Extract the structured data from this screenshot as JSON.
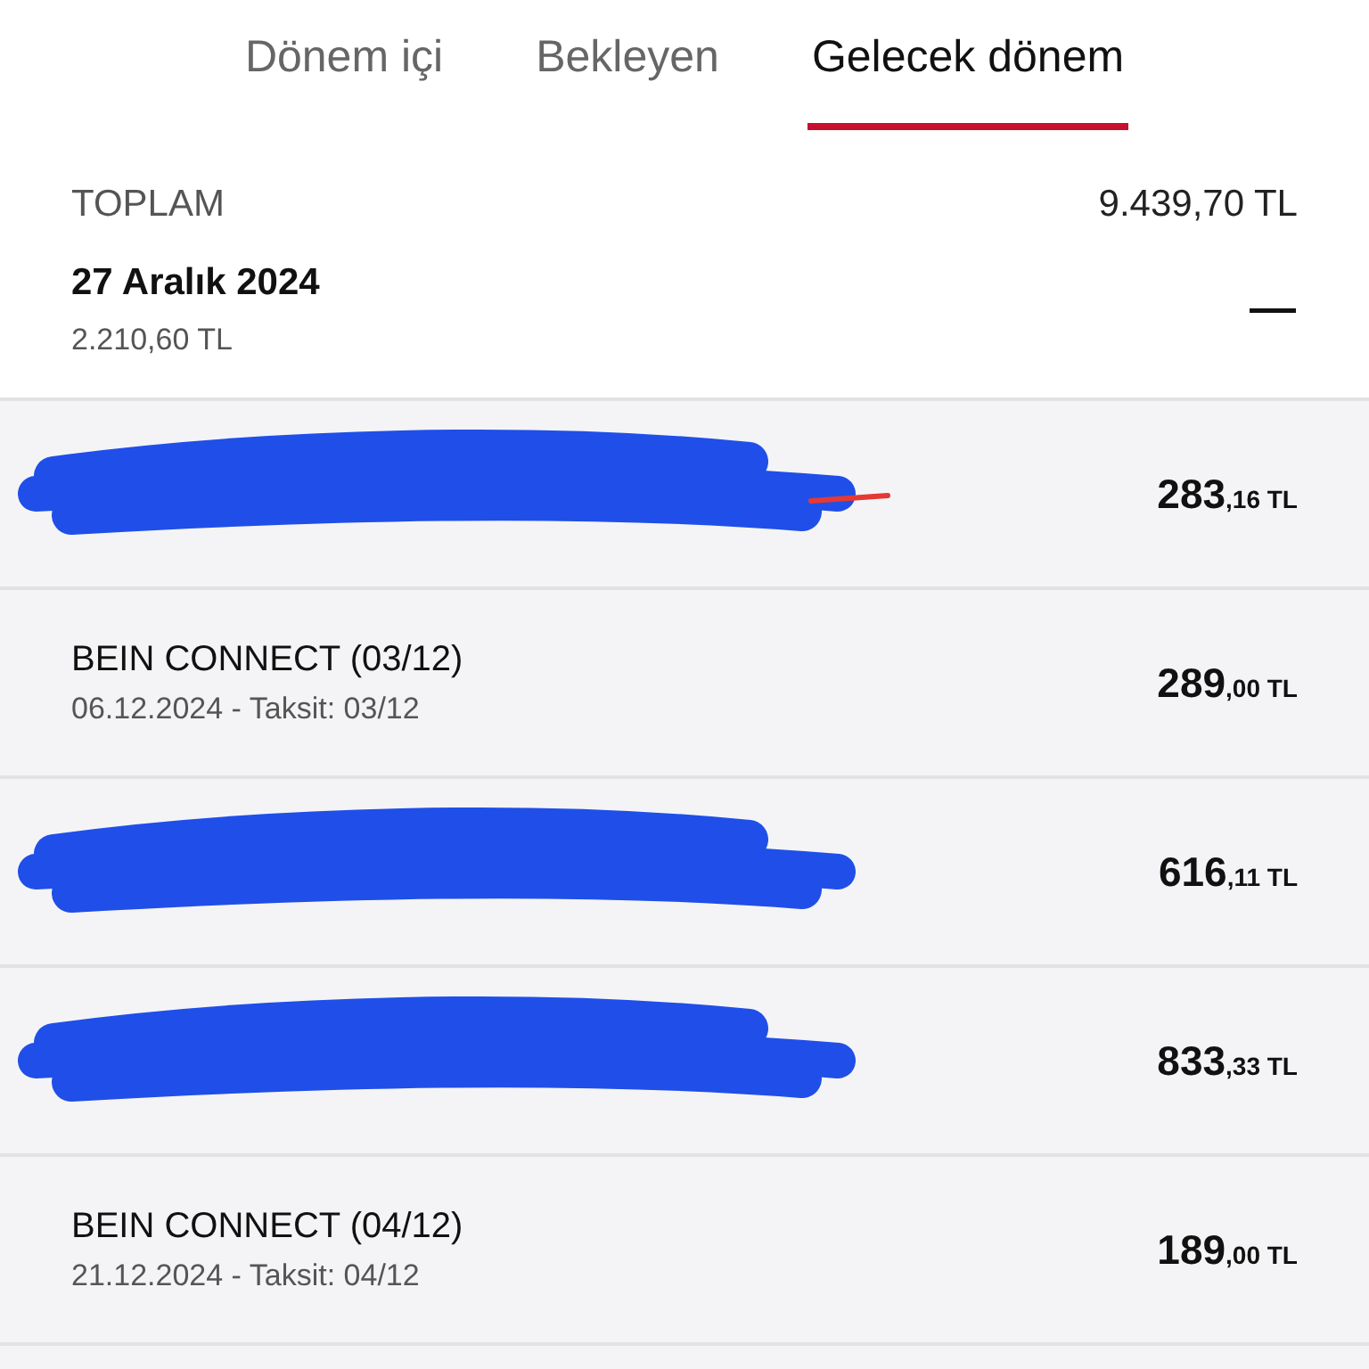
{
  "tabs": [
    {
      "label": "Dönem içi",
      "selected": false
    },
    {
      "label": "Bekleyen",
      "selected": false
    },
    {
      "label": "Gelecek dönem",
      "selected": true
    }
  ],
  "total": {
    "label": "TOPLAM",
    "amount": "9.439,70 TL"
  },
  "group": {
    "date": "27 Aralık 2024",
    "amount": "2.210,60 TL",
    "expanded": true
  },
  "rows": [
    {
      "kind": "redacted",
      "amount_main": "283",
      "amount_cents": ",16 TL"
    },
    {
      "kind": "plain",
      "title": "BEIN CONNECT (03/12)",
      "subtitle": "06.12.2024 - Taksit: 03/12",
      "amount_main": "289",
      "amount_cents": ",00 TL"
    },
    {
      "kind": "redacted",
      "amount_main": "616",
      "amount_cents": ",11 TL"
    },
    {
      "kind": "redacted",
      "amount_main": "833",
      "amount_cents": ",33 TL"
    },
    {
      "kind": "plain",
      "title": "BEIN CONNECT (04/12)",
      "subtitle": "21.12.2024 - Taksit: 04/12",
      "amount_main": "189",
      "amount_cents": ",00 TL"
    }
  ]
}
